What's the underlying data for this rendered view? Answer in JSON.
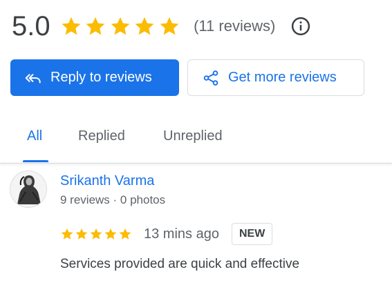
{
  "summary": {
    "score": "5.0",
    "star_rating": 5,
    "review_count": "(11 reviews)",
    "info_icon": "info-icon",
    "star_color": "#fbbc04"
  },
  "actions": {
    "reply_label": "Reply to reviews",
    "reply_icon": "reply-all-icon",
    "get_more_label": "Get more reviews",
    "get_more_icon": "share-icon"
  },
  "tabs": [
    {
      "label": "All",
      "active": true
    },
    {
      "label": "Replied",
      "active": false
    },
    {
      "label": "Unreplied",
      "active": false
    }
  ],
  "review": {
    "reviewer_name": "Srikanth Varma",
    "reviewer_meta": "9 reviews · 0 photos",
    "rating": 5,
    "time": "13 mins ago",
    "badge": "NEW",
    "text": "Services provided are quick and effective",
    "avatar_icon": "avatar"
  },
  "colors": {
    "accent": "#1a73e8",
    "text_primary": "#3c4043",
    "text_secondary": "#5f6368",
    "border": "#dadce0"
  }
}
